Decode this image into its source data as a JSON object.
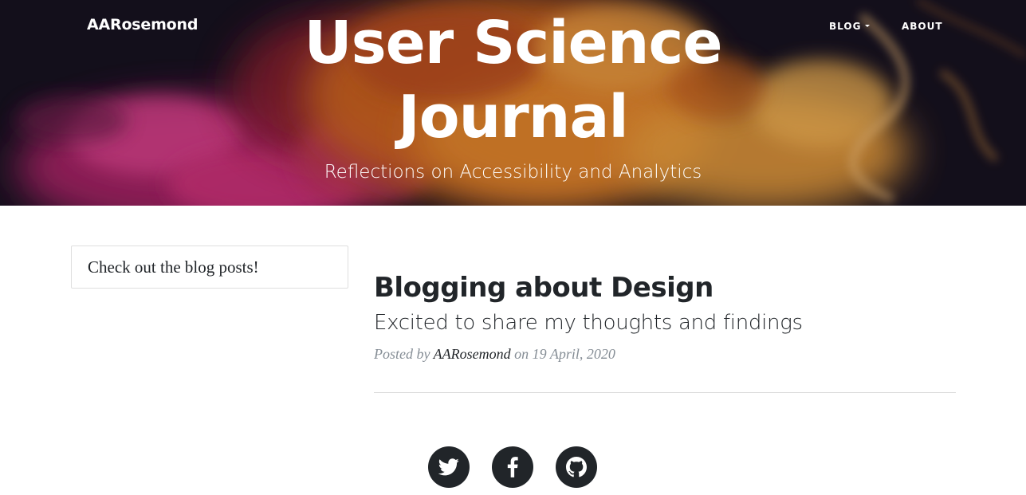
{
  "navbar": {
    "brand": "AARosemond",
    "links": [
      {
        "label": "BLOG",
        "has_dropdown": true
      },
      {
        "label": "ABOUT",
        "has_dropdown": false
      }
    ]
  },
  "hero": {
    "title_line1": "User Science",
    "title_line2": "Journal",
    "subtitle": "Reflections on Accessibility and Analytics"
  },
  "sidebar": {
    "card_text": "Check out the blog posts!"
  },
  "post": {
    "title": "Blogging about Design",
    "subtitle": "Excited to share my thoughts and findings",
    "meta_prefix": "Posted by",
    "author": "AARosemond",
    "meta_on": "on",
    "date": "19 April, 2020"
  },
  "social": [
    {
      "icon": "twitter-icon"
    },
    {
      "icon": "facebook-icon"
    },
    {
      "icon": "github-icon"
    }
  ],
  "colors": {
    "text_dark": "#212529",
    "text_muted": "#868e96",
    "hero_text": "#ffffff",
    "icon_circle": "#212529"
  }
}
